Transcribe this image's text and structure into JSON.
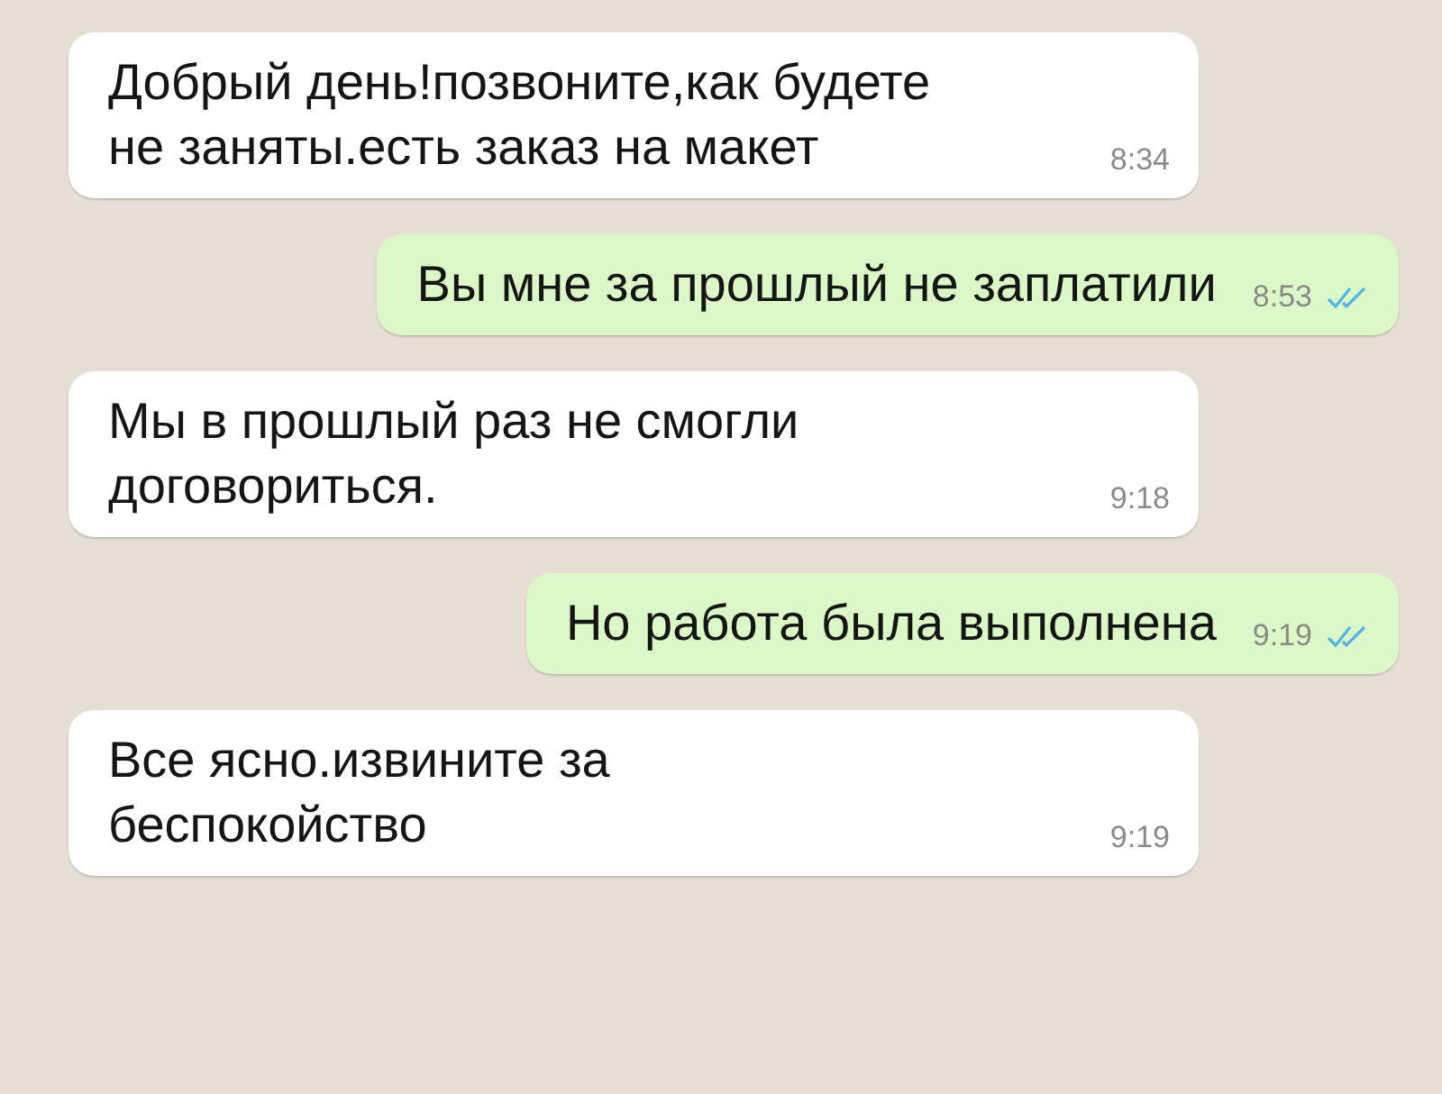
{
  "messages": [
    {
      "outgoing": false,
      "text": "Добрый день!позвоните,как будете не заняты.есть заказ на макет",
      "time": "8:34"
    },
    {
      "outgoing": true,
      "text": "Вы мне за прошлый не заплатили",
      "time": "8:53",
      "read": true
    },
    {
      "outgoing": false,
      "text": "Мы в прошлый раз не смогли договориться.",
      "time": "9:18"
    },
    {
      "outgoing": true,
      "text": "Но работа была выполнена",
      "time": "9:19",
      "read": true
    },
    {
      "outgoing": false,
      "text": "Все ясно.извините за беспокойство",
      "time": "9:19"
    }
  ]
}
